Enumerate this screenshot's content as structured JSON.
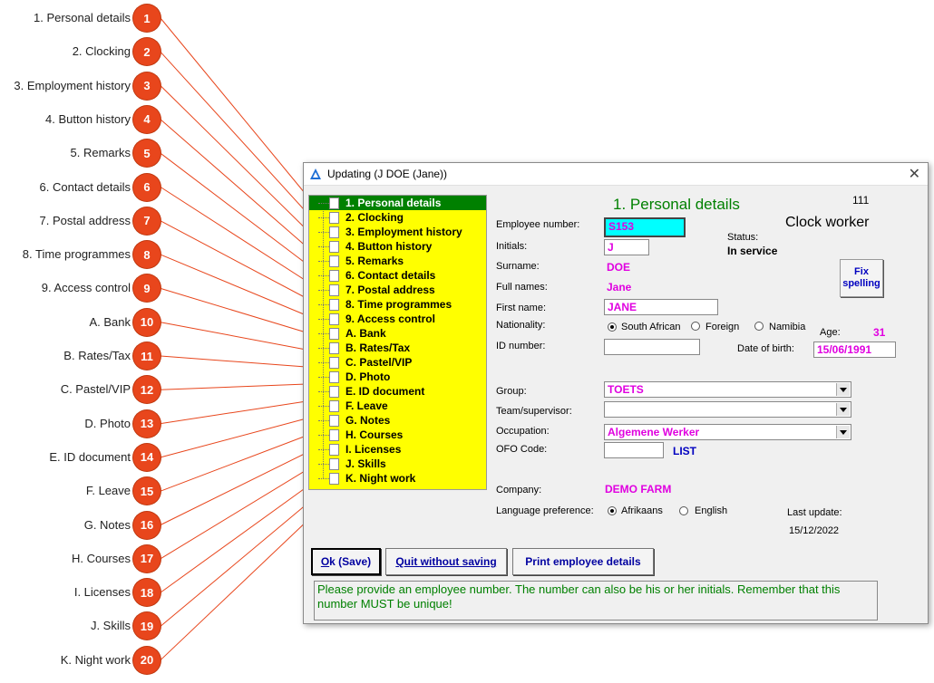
{
  "callouts": [
    {
      "num": "1",
      "label": "1. Personal details"
    },
    {
      "num": "2",
      "label": "2. Clocking"
    },
    {
      "num": "3",
      "label": "3. Employment history"
    },
    {
      "num": "4",
      "label": "4. Button history"
    },
    {
      "num": "5",
      "label": "5. Remarks"
    },
    {
      "num": "6",
      "label": "6. Contact details"
    },
    {
      "num": "7",
      "label": "7. Postal address"
    },
    {
      "num": "8",
      "label": "8. Time programmes"
    },
    {
      "num": "9",
      "label": "9. Access control"
    },
    {
      "num": "10",
      "label": "A. Bank"
    },
    {
      "num": "11",
      "label": "B. Rates/Tax"
    },
    {
      "num": "12",
      "label": "C. Pastel/VIP"
    },
    {
      "num": "13",
      "label": "D. Photo"
    },
    {
      "num": "14",
      "label": "E. ID document"
    },
    {
      "num": "15",
      "label": "F. Leave"
    },
    {
      "num": "16",
      "label": "G. Notes"
    },
    {
      "num": "17",
      "label": "H. Courses"
    },
    {
      "num": "18",
      "label": "I. Licenses"
    },
    {
      "num": "19",
      "label": "J. Skills"
    },
    {
      "num": "20",
      "label": "K. Night work"
    }
  ],
  "window": {
    "title": "Updating  (J DOE (Jane))",
    "close": "✕"
  },
  "tree": {
    "items": [
      "1. Personal details",
      "2. Clocking",
      "3. Employment history",
      "4. Button history",
      "5. Remarks",
      "6. Contact details",
      "7. Postal address",
      "8. Time programmes",
      "9. Access control",
      "A. Bank",
      "B. Rates/Tax",
      "C. Pastel/VIP",
      "D. Photo",
      "E. ID document",
      "F. Leave",
      "G. Notes",
      "H. Courses",
      "I. Licenses",
      "J. Skills",
      "K. Night work"
    ],
    "selected_index": 0,
    "colors": {
      "background": "#ffff00",
      "selected": "#008000"
    }
  },
  "form": {
    "section_title": "1. Personal details",
    "employee_id": "111",
    "worker_type": "Clock worker",
    "status_label": "Status:",
    "status_value": "In service",
    "employee_number_label": "Employee number:",
    "employee_number": "S153",
    "initials_label": "Initials:",
    "initials": "J",
    "surname_label": "Surname:",
    "surname": "DOE",
    "full_names_label": "Full names:",
    "full_names": "Jane",
    "first_name_label": "First name:",
    "first_name": "JANE",
    "nationality_label": "Nationality:",
    "nationality_options": [
      "South African",
      "Foreign",
      "Namibia"
    ],
    "nationality_selected": "South African",
    "age_label": "Age:",
    "age": "31",
    "id_number_label": "ID number:",
    "id_number": "",
    "dob_label": "Date of birth:",
    "dob": "15/06/1991",
    "fix_spelling": "Fix spelling",
    "group_label": "Group:",
    "group": "TOETS",
    "team_label": "Team/supervisor:",
    "team": "",
    "occupation_label": "Occupation:",
    "occupation": "Algemene Werker",
    "ofo_label": "OFO Code:",
    "ofo_code": "",
    "list_link": "LIST",
    "company_label": "Company:",
    "company": "DEMO FARM",
    "language_label": "Language preference:",
    "language_options": [
      "Afrikaans",
      "English"
    ],
    "language_selected": "Afrikaans",
    "last_update_label": "Last update:",
    "last_update": "15/12/2022"
  },
  "buttons": {
    "ok_prefix": "O",
    "ok_rest": "k (Save)",
    "quit_prefix": "Q",
    "quit_rest": "uit without saving",
    "print": "Print employee details"
  },
  "message": "Please provide an employee number. The number can also be his or her initials. Remember that this number MUST be unique!",
  "colors": {
    "accent_green": "#008000",
    "value_magenta": "#e000e0",
    "badge": "#e8461c",
    "link_blue": "#0000c0"
  }
}
